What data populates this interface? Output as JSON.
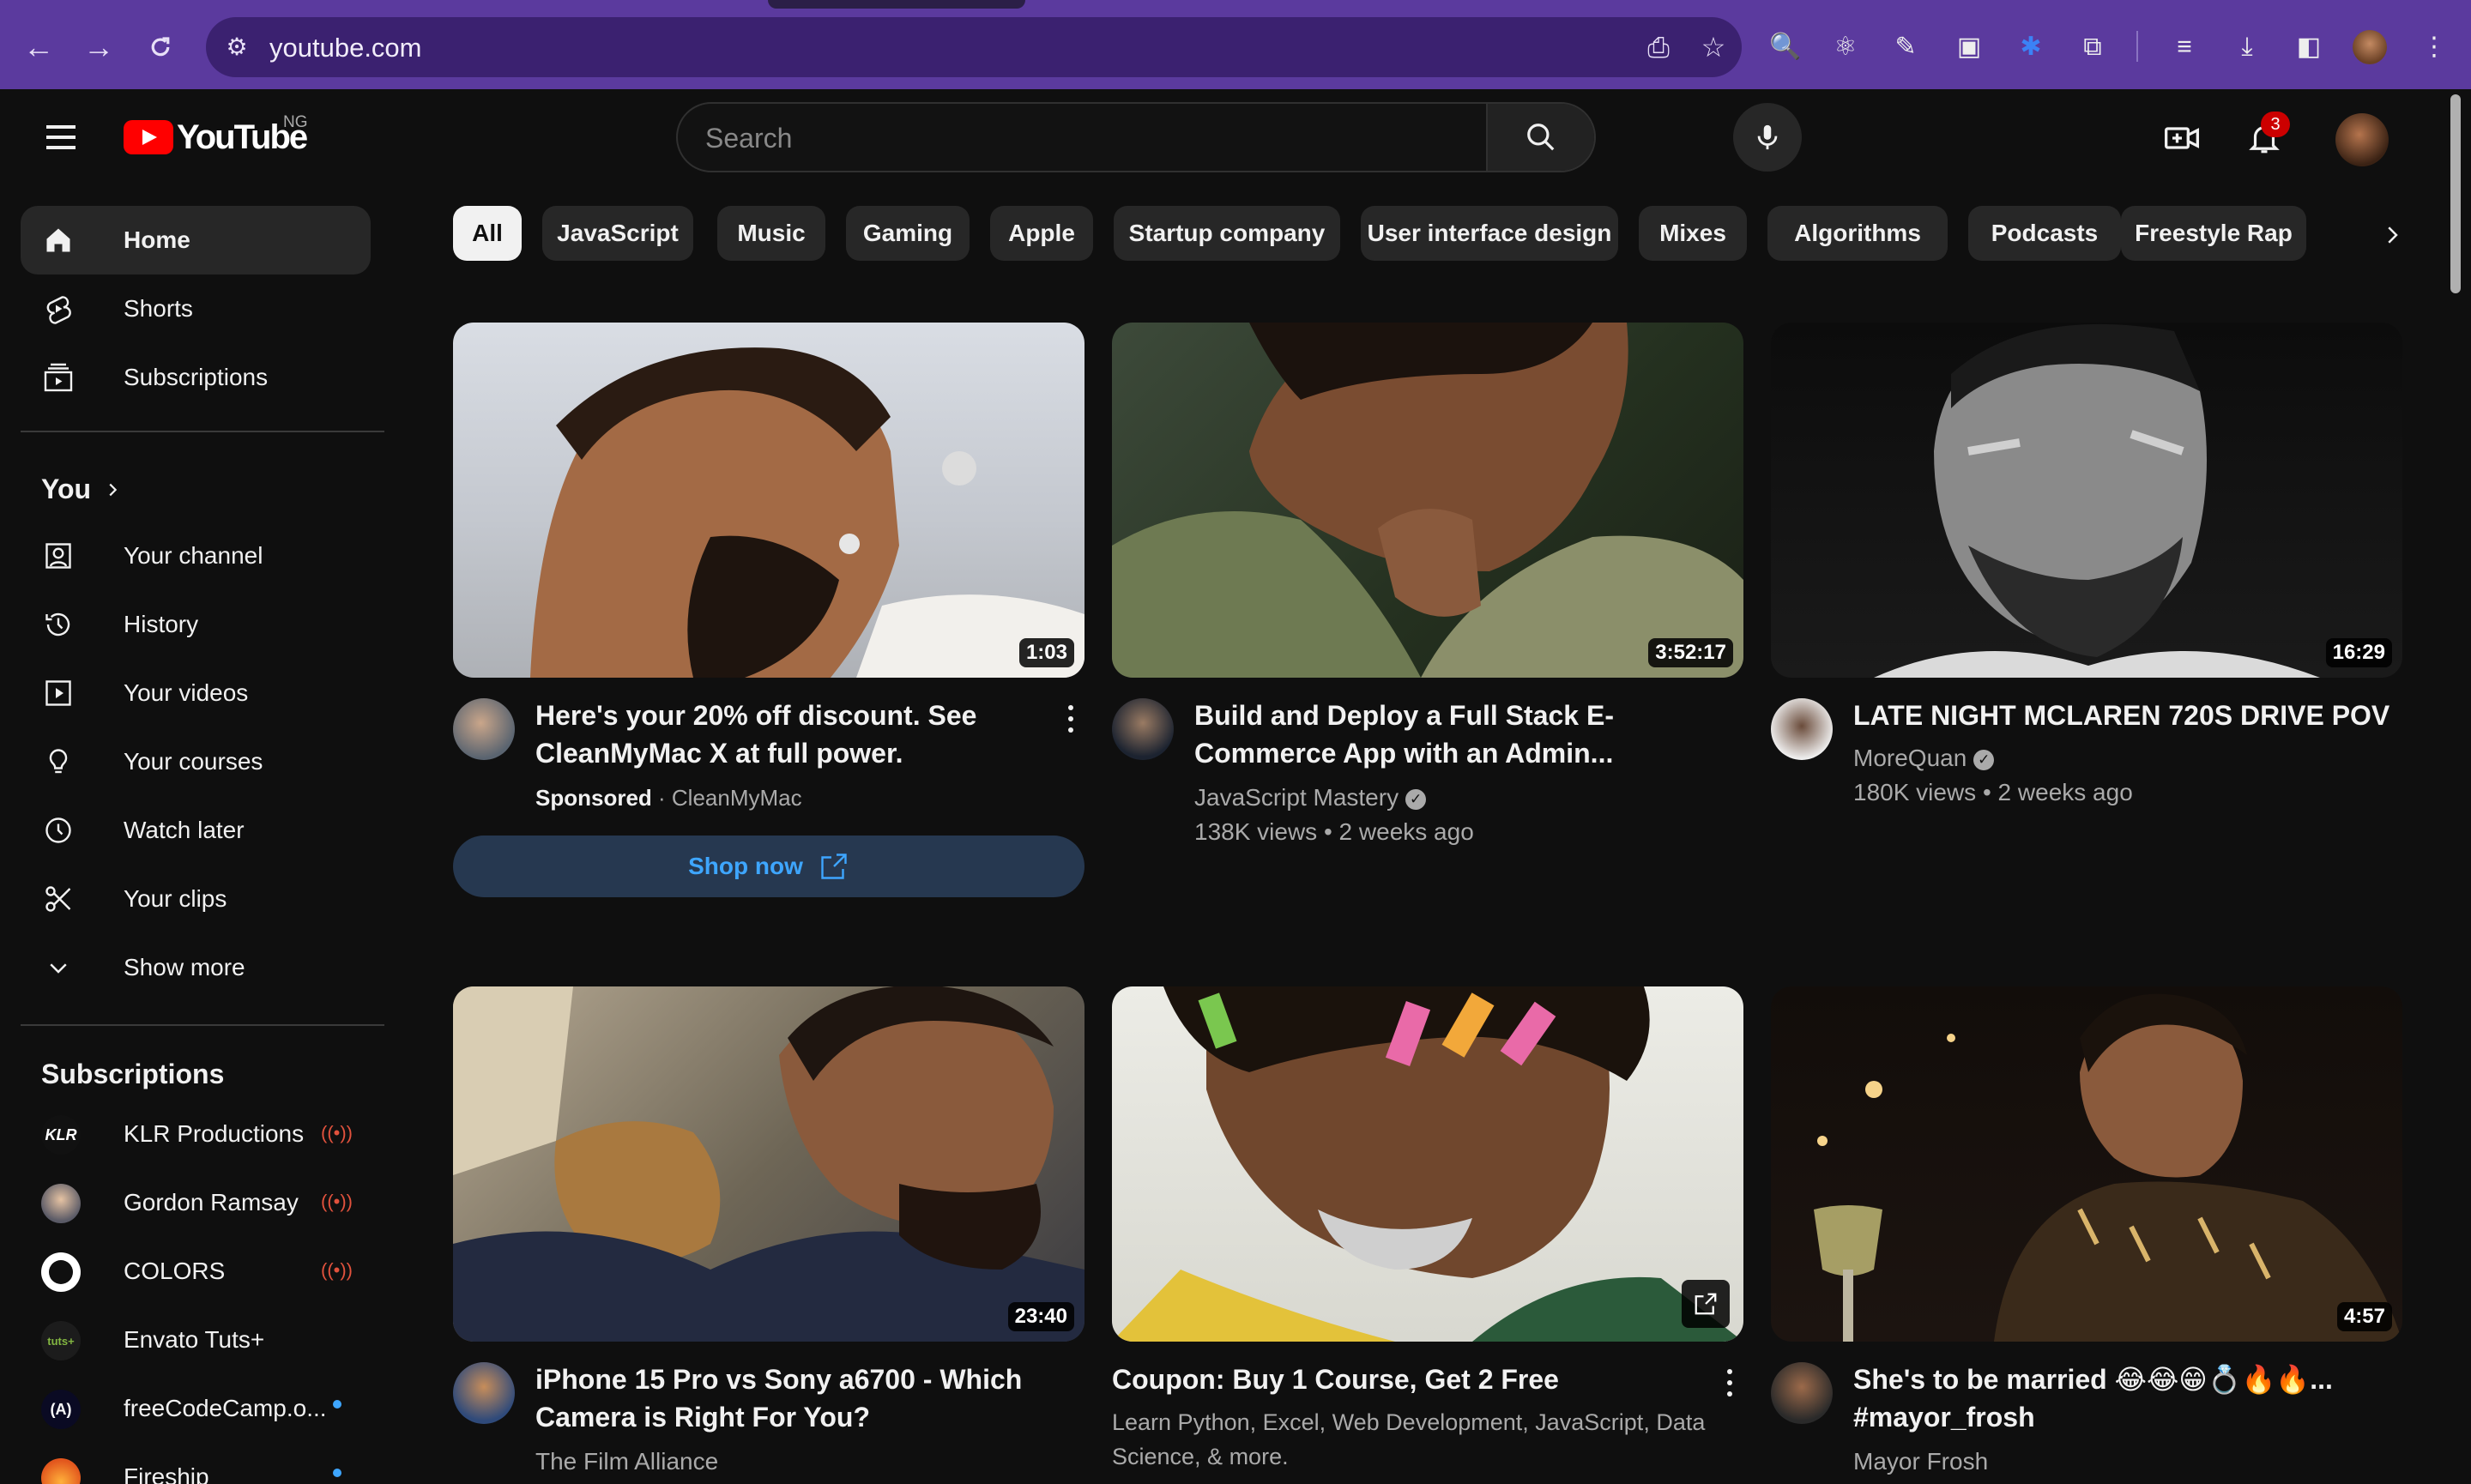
{
  "browser": {
    "url": "youtube.com"
  },
  "header": {
    "logo_text": "YouTube",
    "region": "NG",
    "search_placeholder": "Search",
    "notification_count": "3"
  },
  "sidebar": {
    "main": [
      {
        "label": "Home",
        "icon": "home-icon"
      },
      {
        "label": "Shorts",
        "icon": "shorts-icon"
      },
      {
        "label": "Subscriptions",
        "icon": "subscriptions-icon"
      }
    ],
    "you_heading": "You",
    "you_items": [
      {
        "label": "Your channel",
        "icon": "channel-icon"
      },
      {
        "label": "History",
        "icon": "history-icon"
      },
      {
        "label": "Your videos",
        "icon": "your-videos-icon"
      },
      {
        "label": "Your courses",
        "icon": "courses-icon"
      },
      {
        "label": "Watch later",
        "icon": "watch-later-icon"
      },
      {
        "label": "Your clips",
        "icon": "clips-icon"
      },
      {
        "label": "Show more",
        "icon": "chevron-down-icon"
      }
    ],
    "subscriptions_heading": "Subscriptions",
    "subscriptions": [
      {
        "name": "KLR Productions",
        "avatar_text": "KLR",
        "status": "live"
      },
      {
        "name": "Gordon Ramsay",
        "avatar_text": "",
        "status": "live"
      },
      {
        "name": "COLORS",
        "avatar_text": "",
        "status": "live"
      },
      {
        "name": "Envato Tuts+",
        "avatar_text": "tuts+",
        "status": "none"
      },
      {
        "name": "freeCodeCamp.o...",
        "avatar_text": "(A)",
        "status": "new"
      },
      {
        "name": "Fireship",
        "avatar_text": "",
        "status": "new"
      }
    ]
  },
  "chips": [
    "All",
    "JavaScript",
    "Music",
    "Gaming",
    "Apple",
    "Startup company",
    "User interface design",
    "Mixes",
    "Algorithms",
    "Podcasts",
    "Freestyle Rap"
  ],
  "videos": [
    {
      "title": "Here's your 20% off discount. See CleanMyMac X at full power.",
      "sponsored": "Sponsored",
      "channel": "CleanMyMac",
      "duration": "1:03",
      "cta": "Shop now"
    },
    {
      "title": "Build and Deploy a Full Stack E-Commerce App with an Admin...",
      "channel": "JavaScript Mastery",
      "stats": "138K views • 2 weeks ago",
      "duration": "3:52:17"
    },
    {
      "title": "LATE NIGHT MCLAREN 720S DRIVE POV",
      "channel": "MoreQuan",
      "stats": "180K views • 2 weeks ago",
      "duration": "16:29"
    },
    {
      "title": "iPhone 15 Pro vs Sony a6700 - Which Camera is Right For You?",
      "channel": "The Film Alliance",
      "duration": "23:40"
    },
    {
      "title": "Coupon: Buy 1 Course, Get 2 Free",
      "description": "Learn Python, Excel, Web Development, JavaScript, Data Science, & more.",
      "duration": ""
    },
    {
      "title": "She's to be married 😂😂😁💍🔥🔥... #mayor_frosh",
      "channel": "Mayor Frosh",
      "duration": "4:57"
    }
  ],
  "colors": {
    "browser_frame": "#5b3a9e",
    "background": "#0f0f0f",
    "chip": "#272727",
    "brand_red": "#ff0000",
    "link_blue": "#3ea6ff"
  }
}
